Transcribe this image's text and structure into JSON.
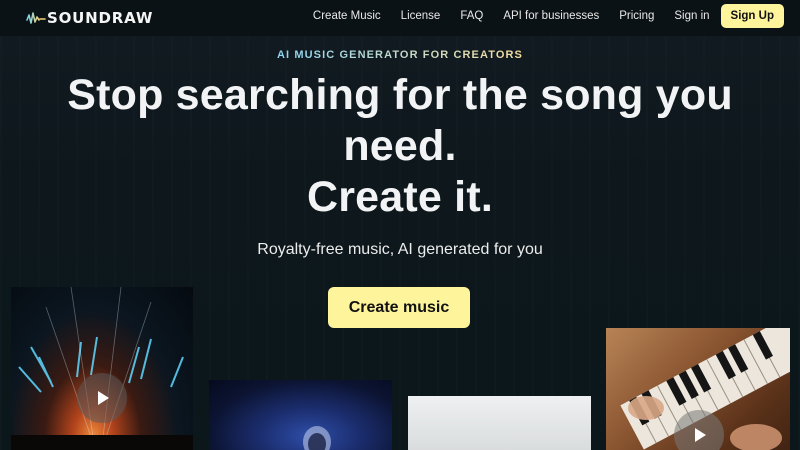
{
  "brand": {
    "name": "SOUNDRAW",
    "logo_icon": "waveform-logo-icon",
    "accent_color": "#fdf49b"
  },
  "nav": {
    "links": [
      "Create Music",
      "License",
      "FAQ",
      "API for businesses",
      "Pricing",
      "Sign in"
    ],
    "signup_label": "Sign Up"
  },
  "hero": {
    "eyebrow": "AI MUSIC GENERATOR FOR CREATORS",
    "headline_line1": "Stop searching for the song you",
    "headline_line2": "need.",
    "headline_line3": "Create it.",
    "subtitle": "Royalty-free music, AI generated for you",
    "cta_label": "Create music"
  },
  "media_cards": [
    {
      "icon": "play-icon",
      "has_play_button": true
    },
    {
      "has_play_button": false
    },
    {
      "has_play_button": false
    },
    {
      "icon": "play-icon",
      "has_play_button": true
    }
  ]
}
